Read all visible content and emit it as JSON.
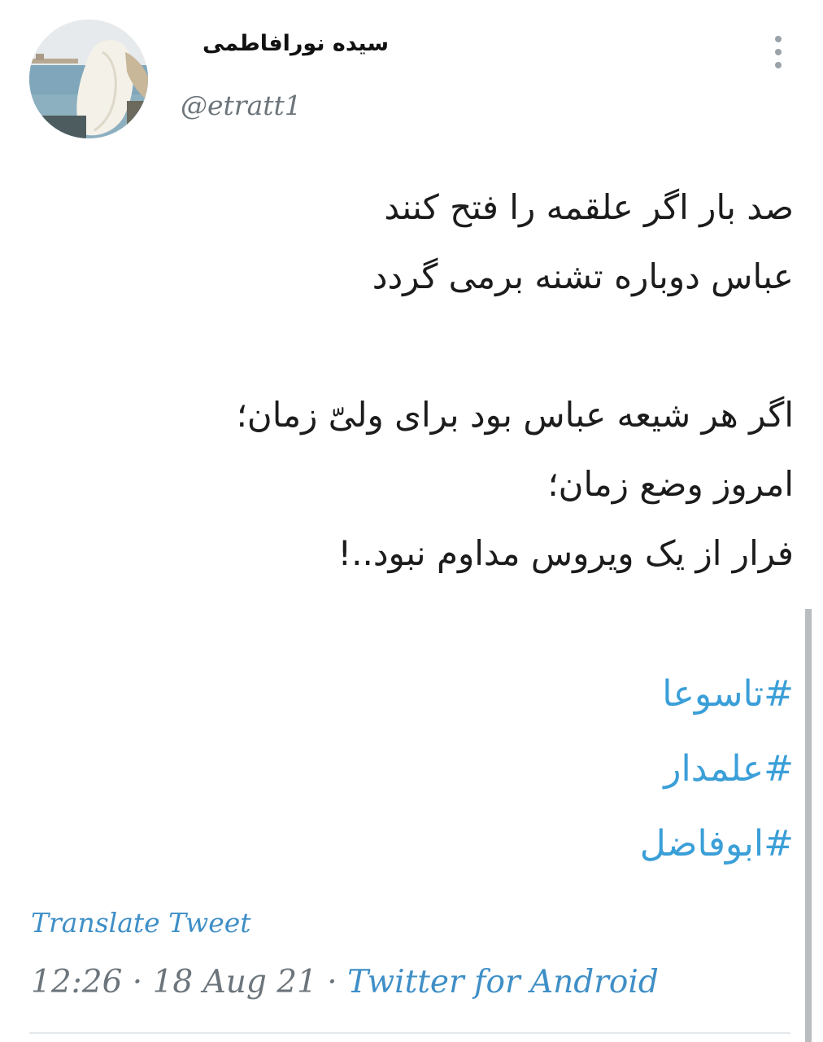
{
  "author": {
    "display_name": "سیده نورافاطمی",
    "handle": "@etratt1",
    "avatar_icon": "profile-photo"
  },
  "tweet": {
    "lines": [
      "صد بار اگر علقمه را فتح کنند",
      "عباس دوباره تشنه برمی گردد",
      "",
      "اگر هر شیعه عباس بود برای ولیّ زمان؛",
      "امروز وضع زمان؛",
      "فرار از یک ویروس مداوم نبود..!"
    ],
    "hashtags": [
      "#تاسوعا",
      "#علمدار",
      "#ابوفاضل"
    ]
  },
  "actions": {
    "translate_label": "Translate Tweet",
    "more_icon": "more-vertical-icon"
  },
  "meta": {
    "time": "12:26",
    "separator1": " · ",
    "date": "18 Aug 21",
    "separator2": " · ",
    "source": "Twitter for Android"
  },
  "colors": {
    "link": "#3f8fc7",
    "hashtag": "#3b9fd8",
    "muted": "#6c757b"
  }
}
